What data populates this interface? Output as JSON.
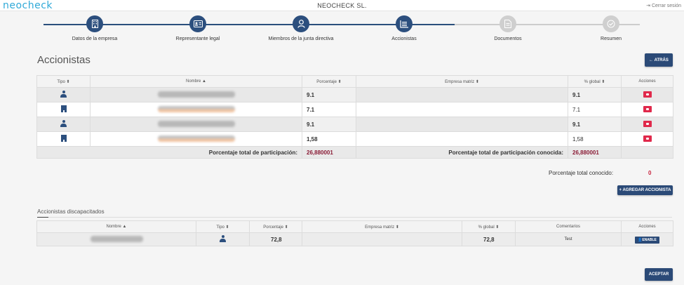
{
  "header": {
    "logo": "neocheck",
    "company": "NEOCHECK SL.",
    "logout": "Cerrar sesión"
  },
  "steps": [
    {
      "label": "Datos de la empresa",
      "icon": "building-icon",
      "state": "done"
    },
    {
      "label": "Representante legal",
      "icon": "id-card-icon",
      "state": "done"
    },
    {
      "label": "Miembros de la junta directiva",
      "icon": "user-icon",
      "state": "done"
    },
    {
      "label": "Accionistas",
      "icon": "list-icon",
      "state": "current"
    },
    {
      "label": "Documentos",
      "icon": "document-icon",
      "state": "pending"
    },
    {
      "label": "Resumen",
      "icon": "check-icon",
      "state": "pending"
    }
  ],
  "page": {
    "title": "Accionistas",
    "back_label": "← ATRÁS"
  },
  "shareholders": {
    "headers": [
      "Tipo ⬍",
      "Nombre ▲",
      "Porcentaje ⬍",
      "Empresa matriz ⬍",
      "% global ⬍",
      "Acciones"
    ],
    "rows": [
      {
        "tipo": "person-icon",
        "porcentaje": "9.1",
        "global": "9.1"
      },
      {
        "tipo": "building-icon",
        "porcentaje": "7.1",
        "global": "7.1"
      },
      {
        "tipo": "person-icon",
        "porcentaje": "9.1",
        "global": "9.1"
      },
      {
        "tipo": "building-icon",
        "porcentaje": "1,58",
        "global": "1,58"
      }
    ],
    "total_label": "Porcentaje total de participación:",
    "total_value": "26,880001",
    "known_label": "Porcentaje total de participación conocida:",
    "known_value": "26,880001"
  },
  "total_conocido": {
    "label": "Porcentaje total conocido:",
    "value": "0"
  },
  "add_label": "+ AGREGAR ACCIONISTA",
  "disabled": {
    "title": "Accionistas discapacitados",
    "headers": [
      "Nombre ▲",
      "Tipo ⬍",
      "Porcentaje ⬍",
      "Empresa matriz ⬍",
      "% global ⬍",
      "Comentarios",
      "Acciones"
    ],
    "row": {
      "tipo": "person-icon",
      "porcentaje": "72,8",
      "global": "72,8",
      "comentario": "Test",
      "enable": "ENABLE"
    }
  },
  "accept_label": "ACEPTAR",
  "colors": {
    "primary": "#2b4a77",
    "danger": "#e0294b",
    "total": "#8a1c36",
    "logo": "#2fa9d8"
  }
}
